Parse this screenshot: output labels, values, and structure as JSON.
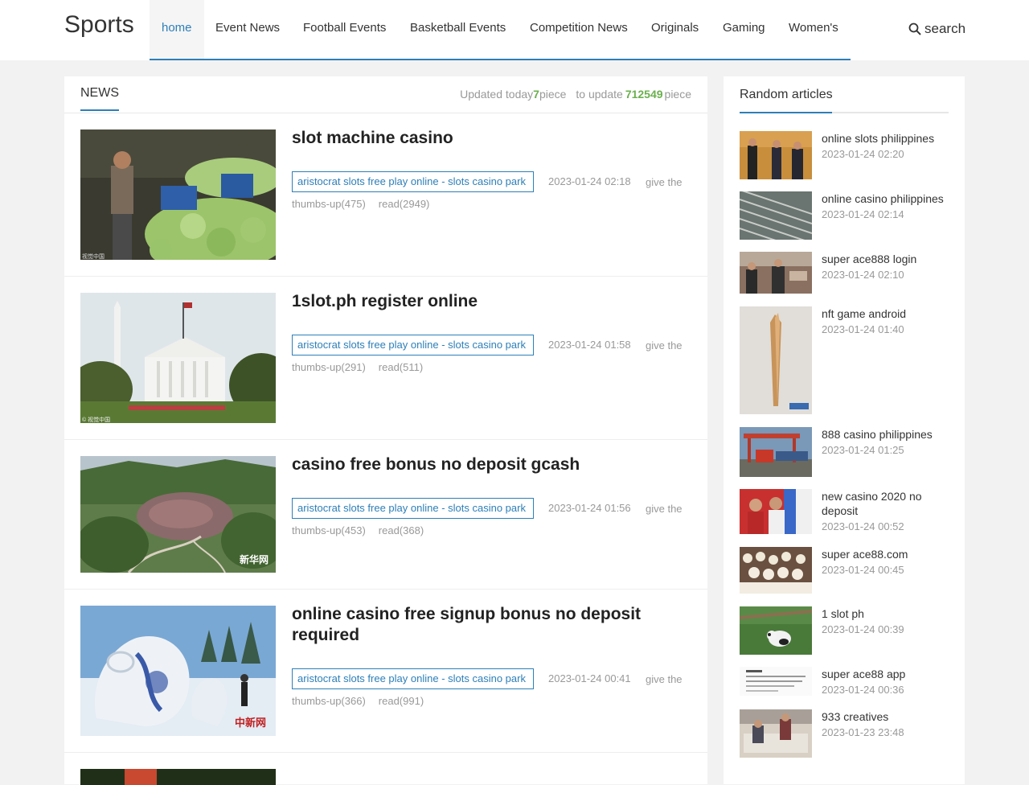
{
  "header": {
    "logo": "Sports",
    "nav": [
      {
        "label": "home",
        "active": true
      },
      {
        "label": "Event News"
      },
      {
        "label": "Football Events"
      },
      {
        "label": "Basketball Events"
      },
      {
        "label": "Competition News"
      },
      {
        "label": "Originals"
      },
      {
        "label": "Gaming"
      },
      {
        "label": "Women's"
      }
    ],
    "search_label": "search"
  },
  "news": {
    "title": "NEWS",
    "stats": {
      "updated_prefix": "Updated today",
      "updated_count": "7",
      "updated_suffix": "piece",
      "total_prefix": "to update",
      "total_count": "712549",
      "total_suffix": "piece"
    },
    "items": [
      {
        "title": "slot machine casino",
        "tag": "aristocrat slots free play online - slots casino park",
        "date": "2023-01-24 02:18",
        "thumbs_label": "give the",
        "thumbs": "thumbs-up(475)",
        "reads": "read(2949)",
        "watermark": "视觉中国"
      },
      {
        "title": "1slot.ph register online",
        "tag": "aristocrat slots free play online - slots casino park",
        "date": "2023-01-24 01:58",
        "thumbs_label": "give the",
        "thumbs": "thumbs-up(291)",
        "reads": "read(511)",
        "watermark": "© 视觉中国"
      },
      {
        "title": "casino free bonus no deposit gcash",
        "tag": "aristocrat slots free play online - slots casino park",
        "date": "2023-01-24 01:56",
        "thumbs_label": "give the",
        "thumbs": "thumbs-up(453)",
        "reads": "read(368)",
        "watermark": "新华网"
      },
      {
        "title": "online casino free signup bonus no deposit required",
        "tag": "aristocrat slots free play online - slots casino park",
        "date": "2023-01-24 00:41",
        "thumbs_label": "give the",
        "thumbs": "thumbs-up(366)",
        "reads": "read(991)",
        "watermark": "中新网"
      }
    ]
  },
  "sidebar": {
    "title": "Random articles",
    "items": [
      {
        "title": "online slots philippines",
        "date": "2023-01-24 02:20"
      },
      {
        "title": "online casino philippines",
        "date": "2023-01-24 02:14"
      },
      {
        "title": "super ace888 login",
        "date": "2023-01-24 02:10"
      },
      {
        "title": "nft game android",
        "date": "2023-01-24 01:40"
      },
      {
        "title": "888 casino philippines",
        "date": "2023-01-24 01:25"
      },
      {
        "title": "new casino 2020 no deposit",
        "date": "2023-01-24 00:52"
      },
      {
        "title": "super ace88.com",
        "date": "2023-01-24 00:45"
      },
      {
        "title": "1 slot ph",
        "date": "2023-01-24 00:39"
      },
      {
        "title": "super ace88 app",
        "date": "2023-01-24 00:36"
      },
      {
        "title": "933 creatives",
        "date": "2023-01-23 23:48"
      }
    ]
  },
  "colors": {
    "accent": "#2d7fb8",
    "count_green": "#6ab04c"
  }
}
